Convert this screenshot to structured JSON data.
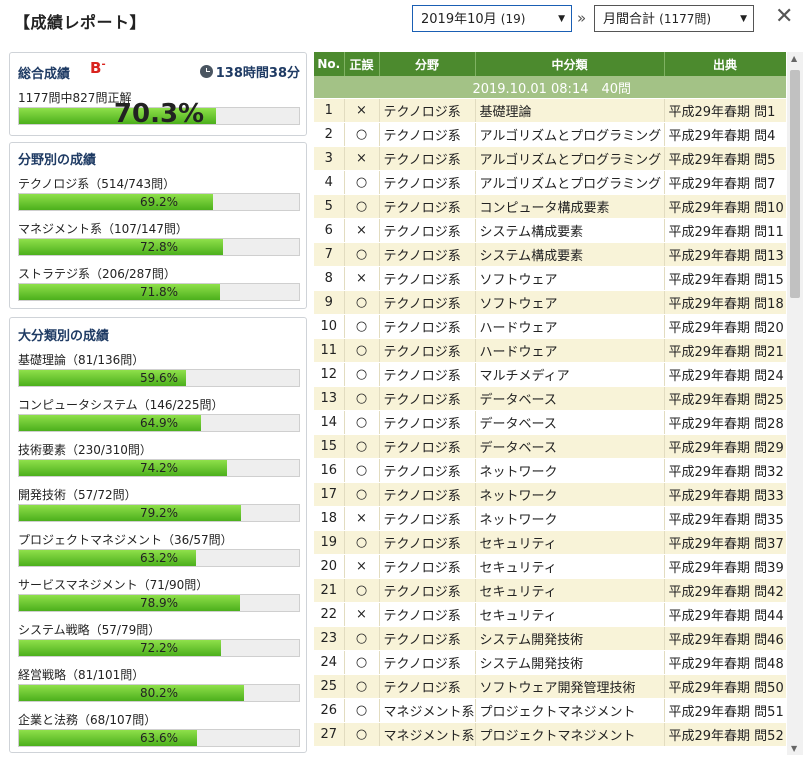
{
  "header": {
    "title": "【成績レポート】",
    "month_select": {
      "value": "2019年10月",
      "count": "(19)"
    },
    "chevron": "»",
    "period_select": {
      "value": "月間合計",
      "count": "(1177問)"
    },
    "close": "✕"
  },
  "summary": {
    "title": "総合成績",
    "grade": "B",
    "grade_mod": "-",
    "time": "138時間38分",
    "correct_text": "1177問中827問正解",
    "percent": "70.3%",
    "percent_value": 70.3
  },
  "fields": {
    "title": "分野別の成績",
    "items": [
      {
        "label": "テクノロジ系（514/743問）",
        "percent": "69.2%",
        "value": 69.2
      },
      {
        "label": "マネジメント系（107/147問）",
        "percent": "72.8%",
        "value": 72.8
      },
      {
        "label": "ストラテジ系（206/287問）",
        "percent": "71.8%",
        "value": 71.8
      }
    ]
  },
  "categories": {
    "title": "大分類別の成績",
    "items": [
      {
        "label": "基礎理論（81/136問）",
        "percent": "59.6%",
        "value": 59.6
      },
      {
        "label": "コンピュータシステム（146/225問）",
        "percent": "64.9%",
        "value": 64.9
      },
      {
        "label": "技術要素（230/310問）",
        "percent": "74.2%",
        "value": 74.2
      },
      {
        "label": "開発技術（57/72問）",
        "percent": "79.2%",
        "value": 79.2
      },
      {
        "label": "プロジェクトマネジメント（36/57問）",
        "percent": "63.2%",
        "value": 63.2
      },
      {
        "label": "サービスマネジメント（71/90問）",
        "percent": "78.9%",
        "value": 78.9
      },
      {
        "label": "システム戦略（57/79問）",
        "percent": "72.2%",
        "value": 72.2
      },
      {
        "label": "経営戦略（81/101問）",
        "percent": "80.2%",
        "value": 80.2
      },
      {
        "label": "企業と法務（68/107問）",
        "percent": "63.6%",
        "value": 63.6
      }
    ]
  },
  "table": {
    "headers": [
      "No.",
      "正誤",
      "分野",
      "中分類",
      "出典"
    ],
    "group": "2019.10.01 08:14　40問",
    "rows": [
      {
        "no": "1",
        "mark": "×",
        "field": "テクノロジ系",
        "sub": "基礎理論",
        "src": "平成29年春期 問1"
      },
      {
        "no": "2",
        "mark": "○",
        "field": "テクノロジ系",
        "sub": "アルゴリズムとプログラミング",
        "src": "平成29年春期 問4"
      },
      {
        "no": "3",
        "mark": "×",
        "field": "テクノロジ系",
        "sub": "アルゴリズムとプログラミング",
        "src": "平成29年春期 問5"
      },
      {
        "no": "4",
        "mark": "○",
        "field": "テクノロジ系",
        "sub": "アルゴリズムとプログラミング",
        "src": "平成29年春期 問7"
      },
      {
        "no": "5",
        "mark": "○",
        "field": "テクノロジ系",
        "sub": "コンピュータ構成要素",
        "src": "平成29年春期 問10"
      },
      {
        "no": "6",
        "mark": "×",
        "field": "テクノロジ系",
        "sub": "システム構成要素",
        "src": "平成29年春期 問11"
      },
      {
        "no": "7",
        "mark": "○",
        "field": "テクノロジ系",
        "sub": "システム構成要素",
        "src": "平成29年春期 問13"
      },
      {
        "no": "8",
        "mark": "×",
        "field": "テクノロジ系",
        "sub": "ソフトウェア",
        "src": "平成29年春期 問15"
      },
      {
        "no": "9",
        "mark": "○",
        "field": "テクノロジ系",
        "sub": "ソフトウェア",
        "src": "平成29年春期 問18"
      },
      {
        "no": "10",
        "mark": "○",
        "field": "テクノロジ系",
        "sub": "ハードウェア",
        "src": "平成29年春期 問20"
      },
      {
        "no": "11",
        "mark": "○",
        "field": "テクノロジ系",
        "sub": "ハードウェア",
        "src": "平成29年春期 問21"
      },
      {
        "no": "12",
        "mark": "○",
        "field": "テクノロジ系",
        "sub": "マルチメディア",
        "src": "平成29年春期 問24"
      },
      {
        "no": "13",
        "mark": "○",
        "field": "テクノロジ系",
        "sub": "データベース",
        "src": "平成29年春期 問25"
      },
      {
        "no": "14",
        "mark": "○",
        "field": "テクノロジ系",
        "sub": "データベース",
        "src": "平成29年春期 問28"
      },
      {
        "no": "15",
        "mark": "○",
        "field": "テクノロジ系",
        "sub": "データベース",
        "src": "平成29年春期 問29"
      },
      {
        "no": "16",
        "mark": "○",
        "field": "テクノロジ系",
        "sub": "ネットワーク",
        "src": "平成29年春期 問32"
      },
      {
        "no": "17",
        "mark": "○",
        "field": "テクノロジ系",
        "sub": "ネットワーク",
        "src": "平成29年春期 問33"
      },
      {
        "no": "18",
        "mark": "×",
        "field": "テクノロジ系",
        "sub": "ネットワーク",
        "src": "平成29年春期 問35"
      },
      {
        "no": "19",
        "mark": "○",
        "field": "テクノロジ系",
        "sub": "セキュリティ",
        "src": "平成29年春期 問37"
      },
      {
        "no": "20",
        "mark": "×",
        "field": "テクノロジ系",
        "sub": "セキュリティ",
        "src": "平成29年春期 問39"
      },
      {
        "no": "21",
        "mark": "○",
        "field": "テクノロジ系",
        "sub": "セキュリティ",
        "src": "平成29年春期 問42"
      },
      {
        "no": "22",
        "mark": "×",
        "field": "テクノロジ系",
        "sub": "セキュリティ",
        "src": "平成29年春期 問44"
      },
      {
        "no": "23",
        "mark": "○",
        "field": "テクノロジ系",
        "sub": "システム開発技術",
        "src": "平成29年春期 問46"
      },
      {
        "no": "24",
        "mark": "○",
        "field": "テクノロジ系",
        "sub": "システム開発技術",
        "src": "平成29年春期 問48"
      },
      {
        "no": "25",
        "mark": "○",
        "field": "テクノロジ系",
        "sub": "ソフトウェア開発管理技術",
        "src": "平成29年春期 問50"
      },
      {
        "no": "26",
        "mark": "○",
        "field": "マネジメント系",
        "sub": "プロジェクトマネジメント",
        "src": "平成29年春期 問51"
      },
      {
        "no": "27",
        "mark": "○",
        "field": "マネジメント系",
        "sub": "プロジェクトマネジメント",
        "src": "平成29年春期 問52"
      }
    ]
  },
  "colors": {
    "header_green": "#4c8a2e",
    "bar_green": "#5cbf1f",
    "grade_red": "#d9231e",
    "title_navy": "#1f3b64"
  }
}
